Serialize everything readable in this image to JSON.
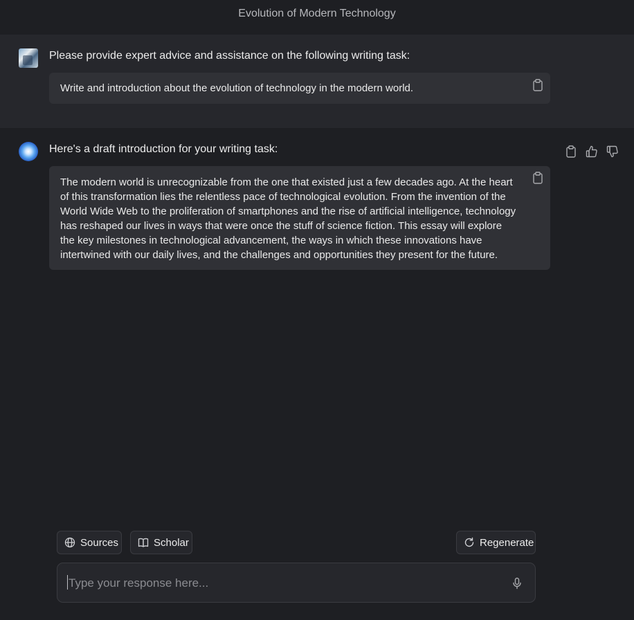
{
  "header": {
    "title": "Evolution of Modern Technology"
  },
  "user_message": {
    "heading": "Please provide expert advice and assistance on the following writing task:",
    "prompt_text": "Write and introduction about the evolution of technology in the modern world."
  },
  "assistant_message": {
    "heading": "Here's a draft introduction for your writing task:",
    "lines": [
      "The modern world is unrecognizable from the one that existed just a few decades ago. At the heart",
      "of this transformation lies the relentless pace of technological evolution. From the invention of the",
      "World Wide Web to the proliferation of smartphones and the rise of artificial intelligence, technology",
      "has reshaped our lives in ways that were once the stuff of science fiction. This essay will explore",
      "the key milestones in technological advancement, the ways in which these innovations have",
      "intertwined with our daily lives, and the challenges and opportunities they present for the future."
    ]
  },
  "toolbar": {
    "sources_label": "Sources",
    "scholar_label": "Scholar",
    "regenerate_label": "Regenerate"
  },
  "composer": {
    "placeholder": "Type your response here..."
  },
  "icons": {
    "copy": "clipboard-icon",
    "like": "thumbs-up-icon",
    "dislike": "thumbs-down-icon",
    "sources": "globe-icon",
    "scholar": "book-icon",
    "regenerate": "refresh-icon",
    "mic": "microphone-icon"
  },
  "colors": {
    "background": "#1e1f23",
    "user_block": "#26272c",
    "card": "#303136",
    "text": "#ececec",
    "muted": "#8a8b90"
  }
}
